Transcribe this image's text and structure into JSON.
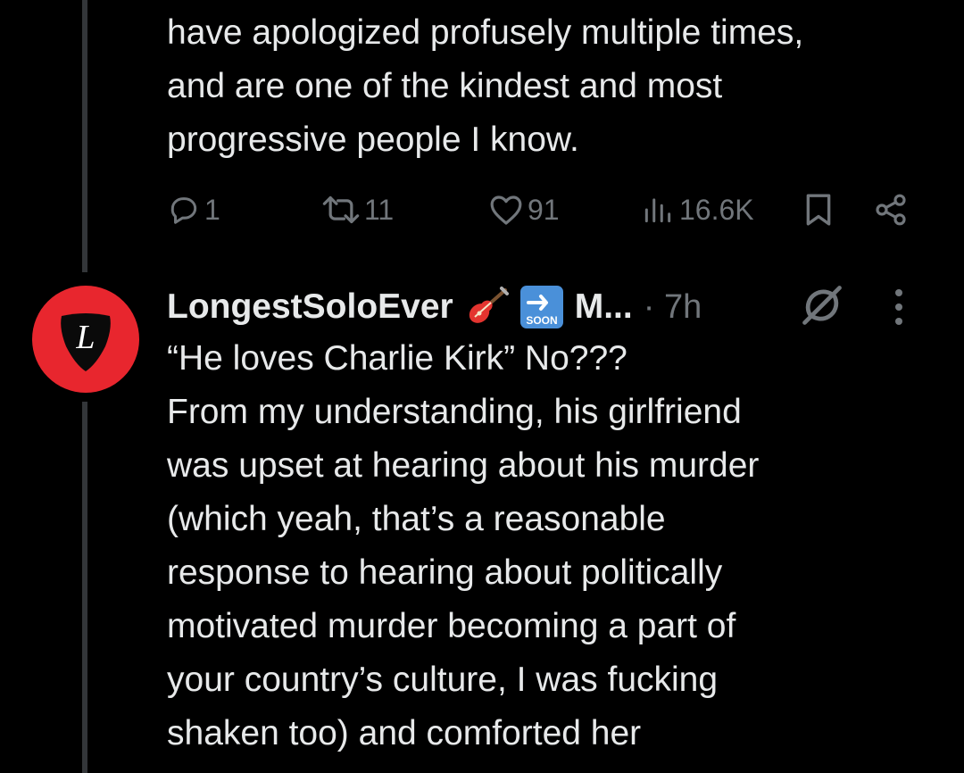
{
  "post_above": {
    "text_lines": [
      "have apologized profusely multiple times,",
      "and are one of the kindest and most",
      "progressive people I know."
    ],
    "actions": {
      "replies": "1",
      "reposts": "11",
      "likes": "91",
      "views": "16.6K"
    }
  },
  "reply": {
    "display_name": "LongestSoloEver",
    "name_truncated": "M...",
    "timestamp": "· 7h",
    "emoji": [
      "guitar-emoji",
      "soon-arrow-emoji"
    ],
    "emoji_label": "SOON",
    "avatar_letter": "L",
    "text_lines": [
      "“He loves Charlie Kirk” No???",
      "From my understanding, his girlfriend",
      "was upset at hearing about his murder",
      "(which yeah, that’s a reasonable",
      "response to hearing about politically",
      "motivated murder becoming a part of",
      "your country’s culture, I was fucking",
      "shaken too) and comforted her"
    ]
  },
  "colors": {
    "background": "#000000",
    "text": "#e7e9ea",
    "muted": "#71767b",
    "thread_line": "#333639",
    "avatar_bg": "#e8262e"
  }
}
